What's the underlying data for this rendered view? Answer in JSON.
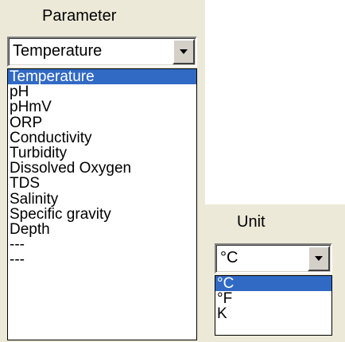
{
  "parameter": {
    "label": "Parameter",
    "selected": "Temperature",
    "options": [
      "Temperature",
      "pH",
      "pHmV",
      "ORP",
      "Conductivity",
      "Turbidity",
      "Dissolved Oxygen",
      "TDS",
      "Salinity",
      "Specific gravity",
      "Depth",
      "---",
      "---"
    ],
    "highlighted": "Temperature"
  },
  "unit": {
    "label": "Unit",
    "selected": "°C",
    "options": [
      "°C",
      "°F",
      "K"
    ],
    "highlighted": "°C"
  },
  "colors": {
    "panel_bg": "#ece9d8",
    "selection_bg": "#316ac5",
    "selection_text": "#ffffff"
  },
  "icons": {
    "dropdown_arrow": "chevron-down-icon"
  }
}
